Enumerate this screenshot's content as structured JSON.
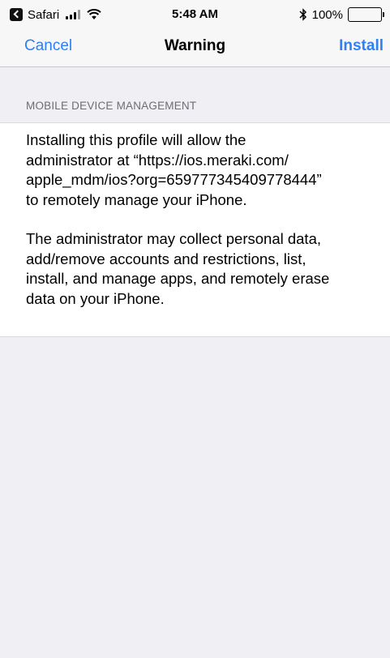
{
  "status_bar": {
    "back_app": "Safari",
    "time": "5:48 AM",
    "battery": "100%",
    "icons": [
      "back-app-icon",
      "signal-icon",
      "wifi-icon",
      "bluetooth-icon",
      "battery-icon"
    ]
  },
  "nav": {
    "cancel": "Cancel",
    "title": "Warning",
    "install": "Install",
    "accent_color": "#2f7ff5"
  },
  "section": {
    "header": "MOBILE DEVICE MANAGEMENT"
  },
  "body": {
    "paragraph1": "Installing this profile will allow the\nadministrator at “https://ios.meraki.com/\napple_mdm/ios?org=659777345409778444”\nto remotely manage your iPhone.",
    "paragraph2": "The administrator may collect personal data,\nadd/remove accounts and restrictions, list,\ninstall, and manage apps, and remotely erase\ndata on your iPhone."
  },
  "colors": {
    "background": "#efeff4",
    "bar": "#f7f7f7",
    "card": "#ffffff",
    "section_text": "#6d6d72"
  }
}
